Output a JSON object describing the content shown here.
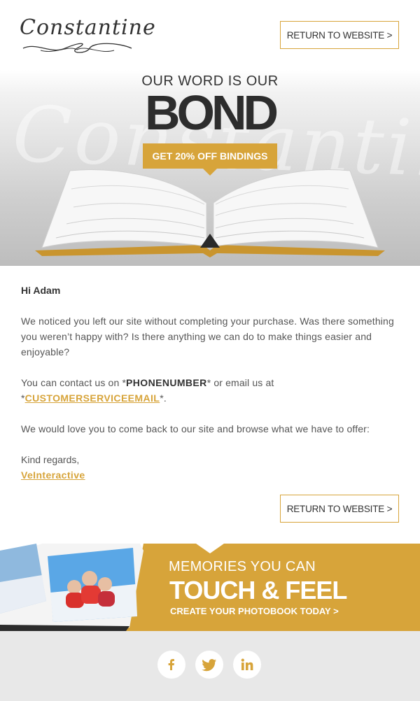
{
  "header": {
    "logo_text": "Constantine",
    "return_label": "RETURN TO WEBSITE >"
  },
  "hero": {
    "line1": "OUR WORD IS OUR",
    "headline": "BOND",
    "cta_label": "GET 20% OFF BINDINGS"
  },
  "message": {
    "greeting": "Hi Adam",
    "para1": "We noticed you left our site without completing your purchase. Was there something you weren’t happy with? Is there anything we can do to make things easier and enjoyable?",
    "contact_prefix": "You can contact us on *",
    "phone": "PHONENUMBER",
    "contact_middle": "* or email us at *",
    "email": "CUSTOMERSERVICEEMAIL",
    "contact_suffix": "*.",
    "para3": "We would love you to come back to our site and browse what we have to offer:",
    "signoff": "Kind regards,",
    "signature_link": "VeInteractive",
    "return_label": "RETURN TO WEBSITE >"
  },
  "banner": {
    "line1": "MEMORIES YOU CAN",
    "line2": "TOUCH & FEEL",
    "cta": "CREATE YOUR PHOTOBOOK TODAY >"
  },
  "footer": {
    "social": [
      "facebook-icon",
      "twitter-icon",
      "linkedin-icon"
    ]
  },
  "colors": {
    "accent": "#d7a43a",
    "text": "#555555",
    "footer_bg": "#e8e8e8"
  }
}
